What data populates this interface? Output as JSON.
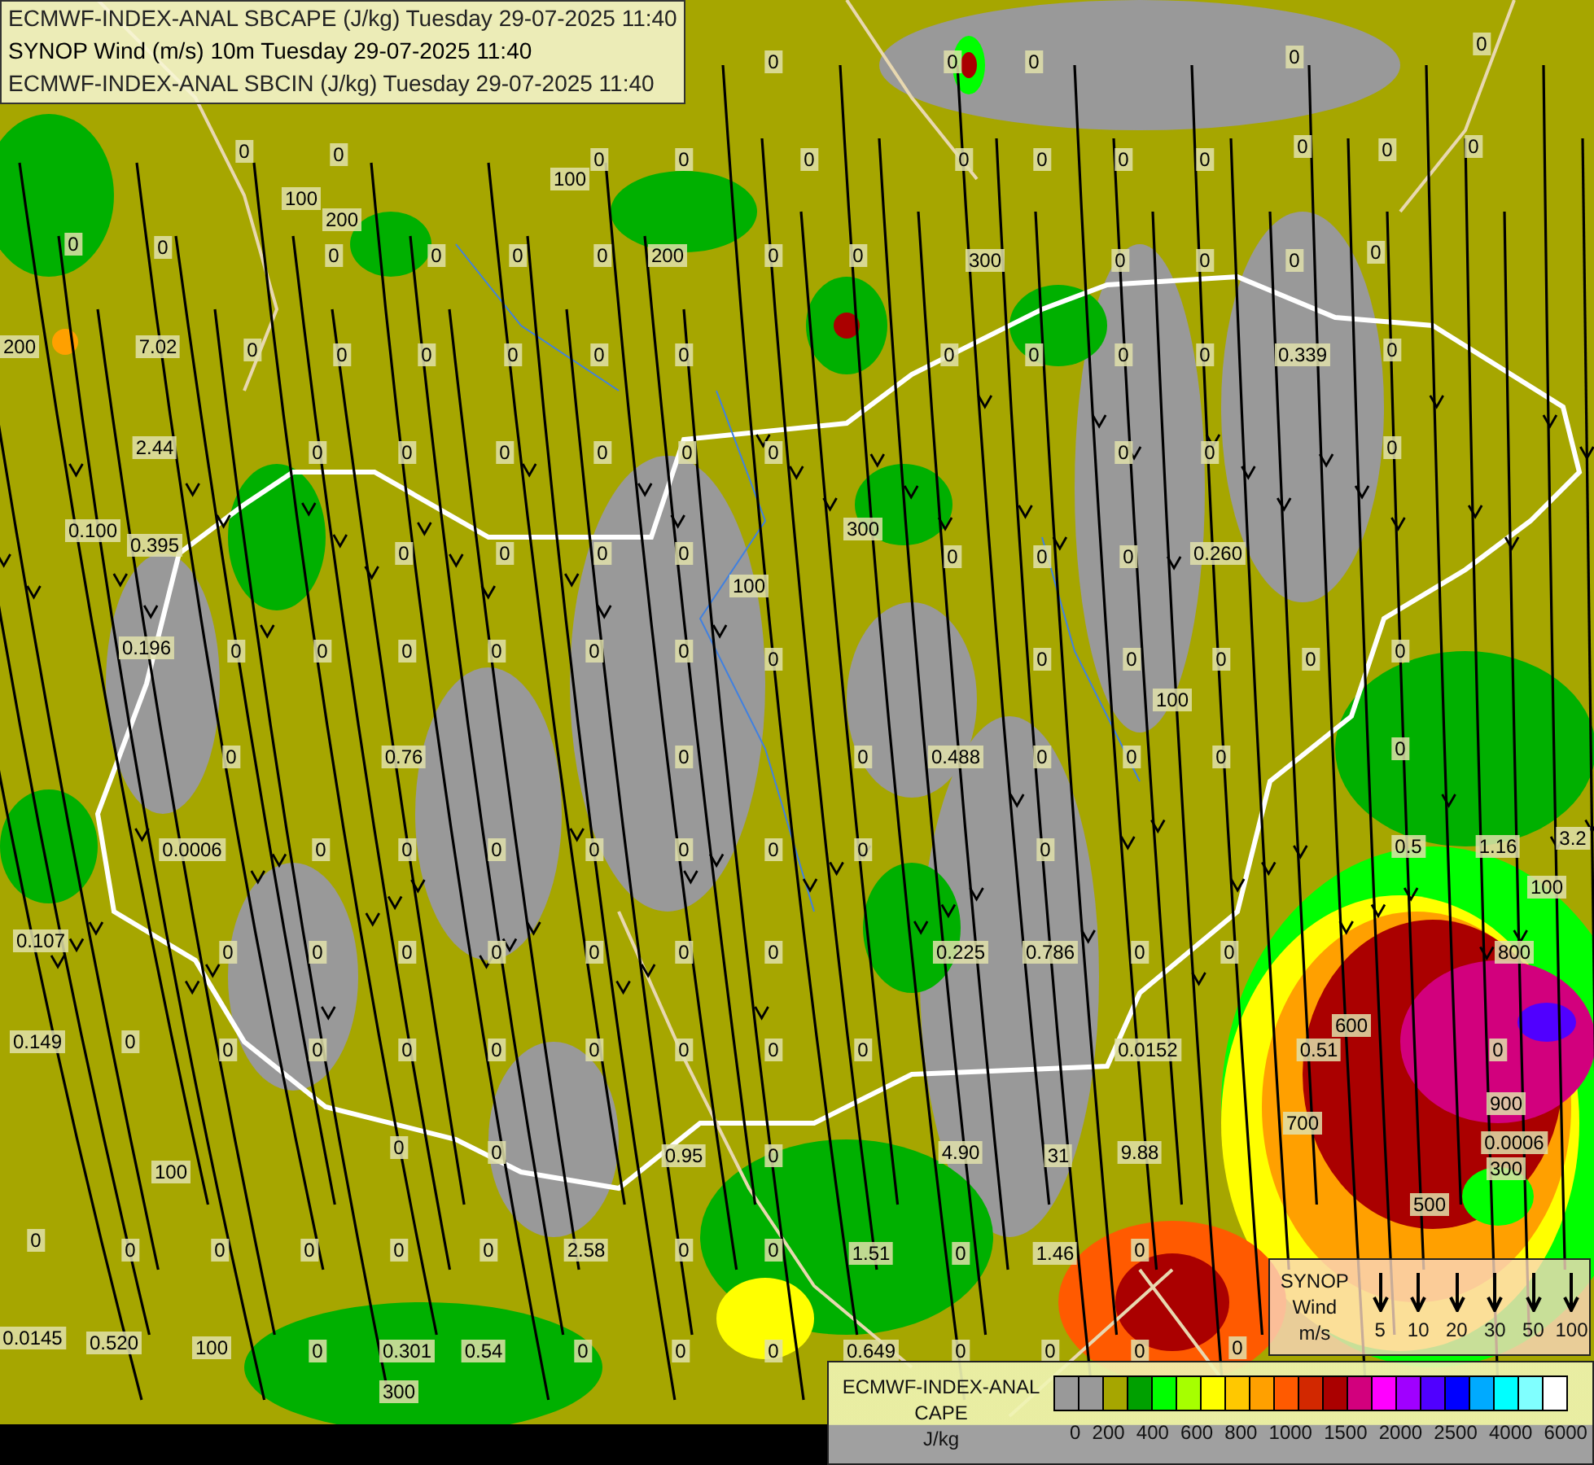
{
  "title_lines": [
    "ECMWF-INDEX-ANAL SBCAPE (J/kg) Tuesday 29-07-2025 11:40",
    "SYNOP Wind (m/s) 10m Tuesday 29-07-2025 11:40",
    "ECMWF-INDEX-ANAL SBCIN (J/kg) Tuesday 29-07-2025 11:40"
  ],
  "map_labels": [
    "0",
    "0",
    "0",
    "0",
    "0",
    "0",
    "0",
    "100",
    "0",
    "0",
    "0",
    "0",
    "0",
    "0",
    "0",
    "0",
    "0",
    "0",
    "100",
    "200",
    "0",
    "0",
    "0",
    "0",
    "0",
    "0",
    "200",
    "0",
    "0",
    "300",
    "0",
    "0",
    "0",
    "0",
    "200",
    "7.02",
    "0",
    "0",
    "0",
    "0",
    "0",
    "0",
    "0",
    "0",
    "0",
    "0",
    "0.339",
    "0",
    "2.44",
    "0",
    "0",
    "0",
    "0",
    "0",
    "0",
    "0",
    "0",
    "0",
    "0.100",
    "0.395",
    "0",
    "0",
    "0",
    "0",
    "0",
    "0",
    "0",
    "0.260",
    "0.196",
    "0",
    "0",
    "0",
    "0",
    "0",
    "0",
    "0",
    "0",
    "0",
    "0",
    "0",
    "0",
    "0",
    "0.76",
    "0",
    "0",
    "0.488",
    "0",
    "0",
    "0",
    "0",
    "0.0006",
    "0",
    "0",
    "0",
    "0",
    "0",
    "0",
    "0",
    "0",
    "0.5",
    "1.16",
    "3.2",
    "0.107",
    "0",
    "0",
    "0",
    "0",
    "0",
    "0",
    "0",
    "0.225",
    "0.786",
    "0",
    "0",
    "0.149",
    "0",
    "0",
    "0",
    "0",
    "0",
    "0",
    "0",
    "0",
    "0",
    "0.0152",
    "0.51",
    "0",
    "0",
    "0",
    "0.95",
    "0",
    "4.90",
    "31",
    "9.88",
    "0.0006",
    "300",
    "0",
    "0",
    "0",
    "0",
    "0",
    "0",
    "2.58",
    "0",
    "0",
    "1.51",
    "0",
    "1.46",
    "0",
    "0.0145",
    "0.520",
    "100",
    "0",
    "0.301",
    "0.54",
    "0",
    "0",
    "0",
    "0.649",
    "0",
    "0",
    "0",
    "0",
    "300",
    "700",
    "900",
    "500",
    "800",
    "100",
    "600",
    "100",
    "100",
    "300",
    "100"
  ],
  "wind_legend": {
    "lines": [
      "SYNOP",
      "Wind",
      "m/s"
    ],
    "speeds": [
      "5",
      "10",
      "20",
      "30",
      "50",
      "100"
    ]
  },
  "cape_legend": {
    "lines": [
      "ECMWF-INDEX-ANAL",
      "CAPE",
      "J/kg"
    ],
    "swatches": [
      {
        "color": "#999999"
      },
      {
        "color": "#999999"
      },
      {
        "color": "#a6a600"
      },
      {
        "color": "#00a000"
      },
      {
        "color": "#00ff00"
      },
      {
        "color": "#a6ff00"
      },
      {
        "color": "#ffff00"
      },
      {
        "color": "#ffc800"
      },
      {
        "color": "#ffa000"
      },
      {
        "color": "#ff5a00"
      },
      {
        "color": "#d22800"
      },
      {
        "color": "#aa0000"
      },
      {
        "color": "#d2007d"
      },
      {
        "color": "#ff00ff"
      },
      {
        "color": "#a000ff"
      },
      {
        "color": "#5000ff"
      },
      {
        "color": "#0000ff"
      },
      {
        "color": "#00aaff"
      },
      {
        "color": "#00ffff"
      },
      {
        "color": "#80ffff"
      },
      {
        "color": "#ffffff"
      }
    ],
    "ticks": [
      "0",
      "200",
      "400",
      "600",
      "800",
      "1000",
      "1500",
      "2000",
      "2500",
      "4000",
      "6000"
    ]
  }
}
